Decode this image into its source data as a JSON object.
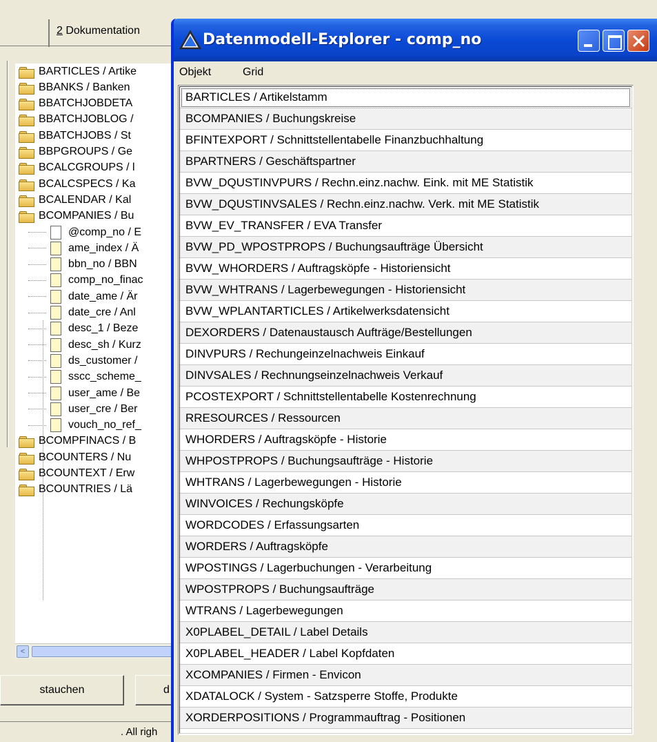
{
  "background_app": {
    "tab_label_number": "2",
    "tab_label_text": " Dokumentation",
    "tree": {
      "folders_top": [
        "BARTICLES / Artike",
        "BBANKS / Banken",
        "BBATCHJOBDETA",
        "BBATCHJOBLOG /",
        "BBATCHJOBS / St",
        "BBPGROUPS / Ge",
        "BCALCGROUPS / l",
        "BCALCSPECS / Ka",
        "BCALENDAR / Kal",
        "BCOMPANIES / Bu"
      ],
      "children": [
        "@comp_no / E",
        "ame_index / Ä",
        "bbn_no / BBN",
        "comp_no_finac",
        "date_ame / Är",
        "date_cre / Anl",
        "desc_1 / Beze",
        "desc_sh / Kurz",
        "ds_customer /",
        "sscc_scheme_",
        "user_ame / Be",
        "user_cre / Ber",
        "vouch_no_ref_"
      ],
      "folders_bottom": [
        "BCOMPFINACS / B",
        "BCOUNTERS / Nu",
        "BCOUNTEXT / Erw",
        "BCOUNTRIES / Lä"
      ]
    },
    "scroll_left_arrow": "<",
    "buttons": {
      "collapse_label": "stauchen",
      "second_label": "d"
    },
    "status_text": ". All righ"
  },
  "window": {
    "title": "Datenmodell-Explorer - comp_no",
    "menu": [
      "Objekt",
      "Grid"
    ],
    "rows": [
      "BARTICLES / Artikelstamm",
      "BCOMPANIES / Buchungskreise",
      "BFINTEXPORT / Schnittstellentabelle Finanzbuchhaltung",
      "BPARTNERS / Geschäftspartner",
      "BVW_DQUSTINVPURS / Rechn.einz.nachw. Eink. mit ME Statistik",
      "BVW_DQUSTINVSALES / Rechn.einz.nachw. Verk. mit ME Statistik",
      "BVW_EV_TRANSFER / EVA Transfer",
      "BVW_PD_WPOSTPROPS / Buchungsaufträge Übersicht",
      "BVW_WHORDERS / Auftragsköpfe - Historiensicht",
      "BVW_WHTRANS / Lagerbewegungen - Historiensicht",
      "BVW_WPLANTARTICLES / Artikelwerksdatensicht",
      "DEXORDERS / Datenaustausch Aufträge/Bestellungen",
      "DINVPURS / Rechungeinzelnachweis Einkauf",
      "DINVSALES / Rechnungseinzelnachweis Verkauf",
      "PCOSTEXPORT / Schnittstellentabelle Kostenrechnung",
      "RRESOURCES / Ressourcen",
      "WHORDERS / Auftragsköpfe - Historie",
      "WHPOSTPROPS / Buchungsaufträge - Historie",
      "WHTRANS / Lagerbewegungen - Historie",
      "WINVOICES / Rechungsköpfe",
      "WORDCODES / Erfassungsarten",
      "WORDERS / Auftragsköpfe",
      "WPOSTINGS / Lagerbuchungen - Verarbeitung",
      "WPOSTPROPS / Buchungsaufträge",
      "WTRANS / Lagerbewegungen",
      "X0PLABEL_DETAIL / Label Details",
      "X0PLABEL_HEADER / Label Kopfdaten",
      "XCOMPANIES / Firmen - Envicon",
      "XDATALOCK / System - Satzsperre Stoffe, Produkte",
      "XORDERPOSITIONS / Programmauftrag - Positionen"
    ]
  }
}
